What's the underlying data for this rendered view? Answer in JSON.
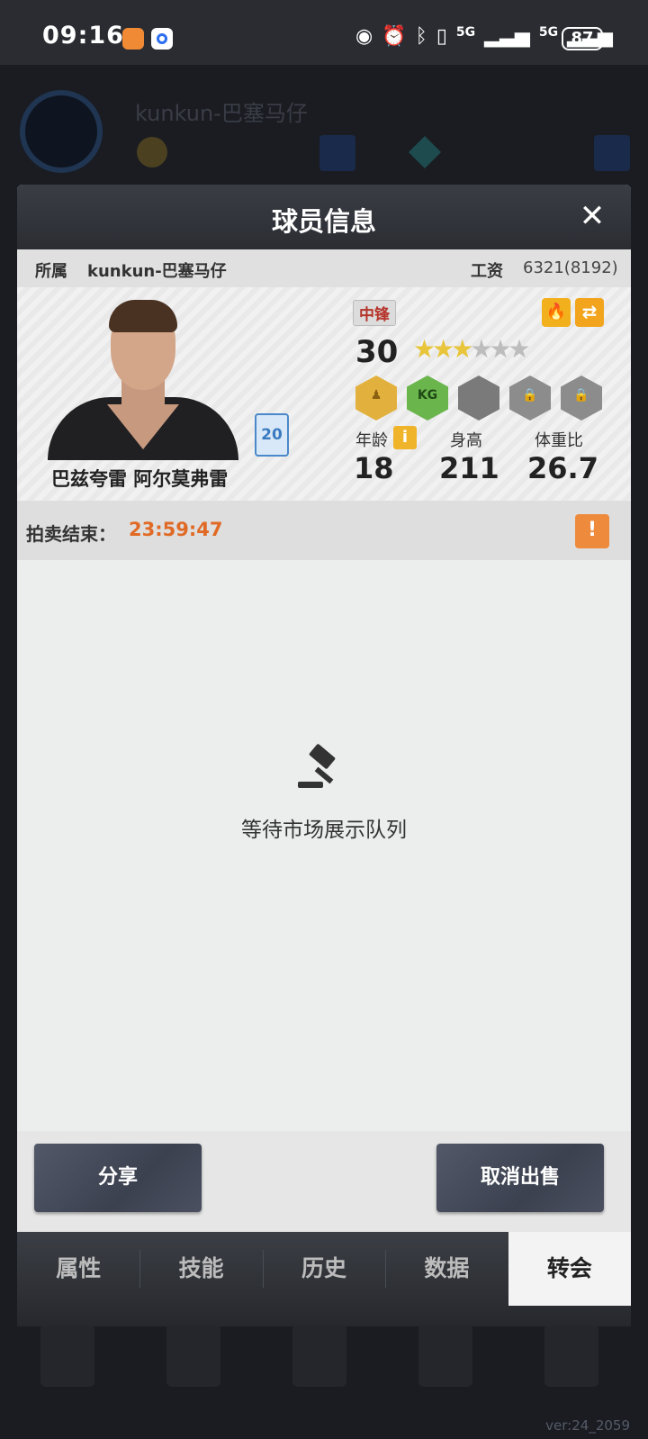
{
  "status_bar": {
    "time": "09:16",
    "signal1": "5G",
    "signal2": "5G",
    "battery": "87"
  },
  "background": {
    "username": "kunkun-巴塞马仔",
    "version": "ver:24_2059"
  },
  "modal": {
    "title": "球员信息",
    "close": "✕",
    "owner_label": "所属",
    "owner_name": "kunkun-巴塞马仔",
    "salary_label": "工资",
    "salary_value": "6321(8192)"
  },
  "player": {
    "name": "巴兹夸雷 阿尔莫弗雷",
    "jersey_number": "20",
    "position": "中锋",
    "rating": "30",
    "stars_filled": 3,
    "stars_total": 6,
    "badges": [
      "player-badge",
      "KG",
      "locked",
      "locked",
      "locked"
    ],
    "age_label": "年龄",
    "age": "18",
    "height_label": "身高",
    "height": "211",
    "weight_ratio_label": "体重比",
    "weight_ratio": "26.7"
  },
  "auction": {
    "label": "拍卖结束：",
    "time_left": "23:59:47"
  },
  "queue": {
    "message": "等待市场展示队列"
  },
  "buttons": {
    "share": "分享",
    "cancel_sale": "取消出售"
  },
  "tabs": [
    {
      "label": "属性",
      "active": false
    },
    {
      "label": "技能",
      "active": false
    },
    {
      "label": "历史",
      "active": false
    },
    {
      "label": "数据",
      "active": false
    },
    {
      "label": "转会",
      "active": true
    }
  ],
  "colors": {
    "accent_orange": "#e06a25",
    "warning": "#ee8a3c",
    "position_red": "#b5342a",
    "badge_green": "#4a9a3a"
  }
}
